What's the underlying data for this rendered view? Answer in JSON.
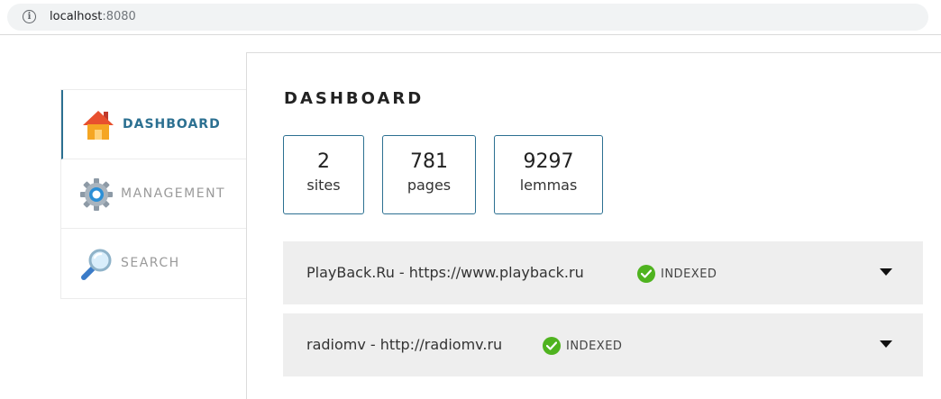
{
  "browser": {
    "url_host": "localhost",
    "url_port": ":8080"
  },
  "sidebar": {
    "items": [
      {
        "label": "DASHBOARD",
        "icon": "house-icon",
        "active": true
      },
      {
        "label": "MANAGEMENT",
        "icon": "gear-icon",
        "active": false
      },
      {
        "label": "SEARCH",
        "icon": "magnifier-icon",
        "active": false
      }
    ]
  },
  "main": {
    "title": "DASHBOARD",
    "stats": [
      {
        "value": "2",
        "label": "sites"
      },
      {
        "value": "781",
        "label": "pages"
      },
      {
        "value": "9297",
        "label": "lemmas"
      }
    ],
    "sites": [
      {
        "name": "PlayBack.Ru - https://www.playback.ru",
        "status": "INDEXED"
      },
      {
        "name": "radiomv - http://radiomv.ru",
        "status": "INDEXED"
      }
    ]
  },
  "colors": {
    "accent": "#2c7091",
    "status_ok": "#4fb31f",
    "row_bg": "#eeeeee"
  }
}
